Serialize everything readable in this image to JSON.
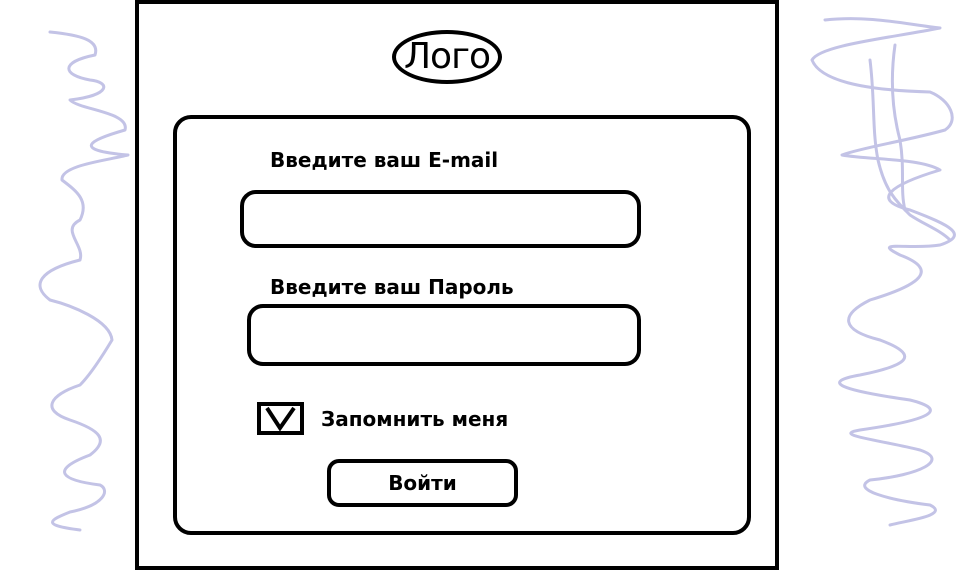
{
  "logo": {
    "text": "Лого"
  },
  "form": {
    "email_label": "Введите ваш E-mail",
    "email_value": "",
    "password_label": "Введите ваш Пароль",
    "password_value": "",
    "remember_label": "Запомнить меня",
    "remember_checked": true,
    "submit_label": "Войти"
  },
  "colors": {
    "ink": "#000000",
    "background": "#ffffff",
    "scribble": "#c3c3e6"
  }
}
